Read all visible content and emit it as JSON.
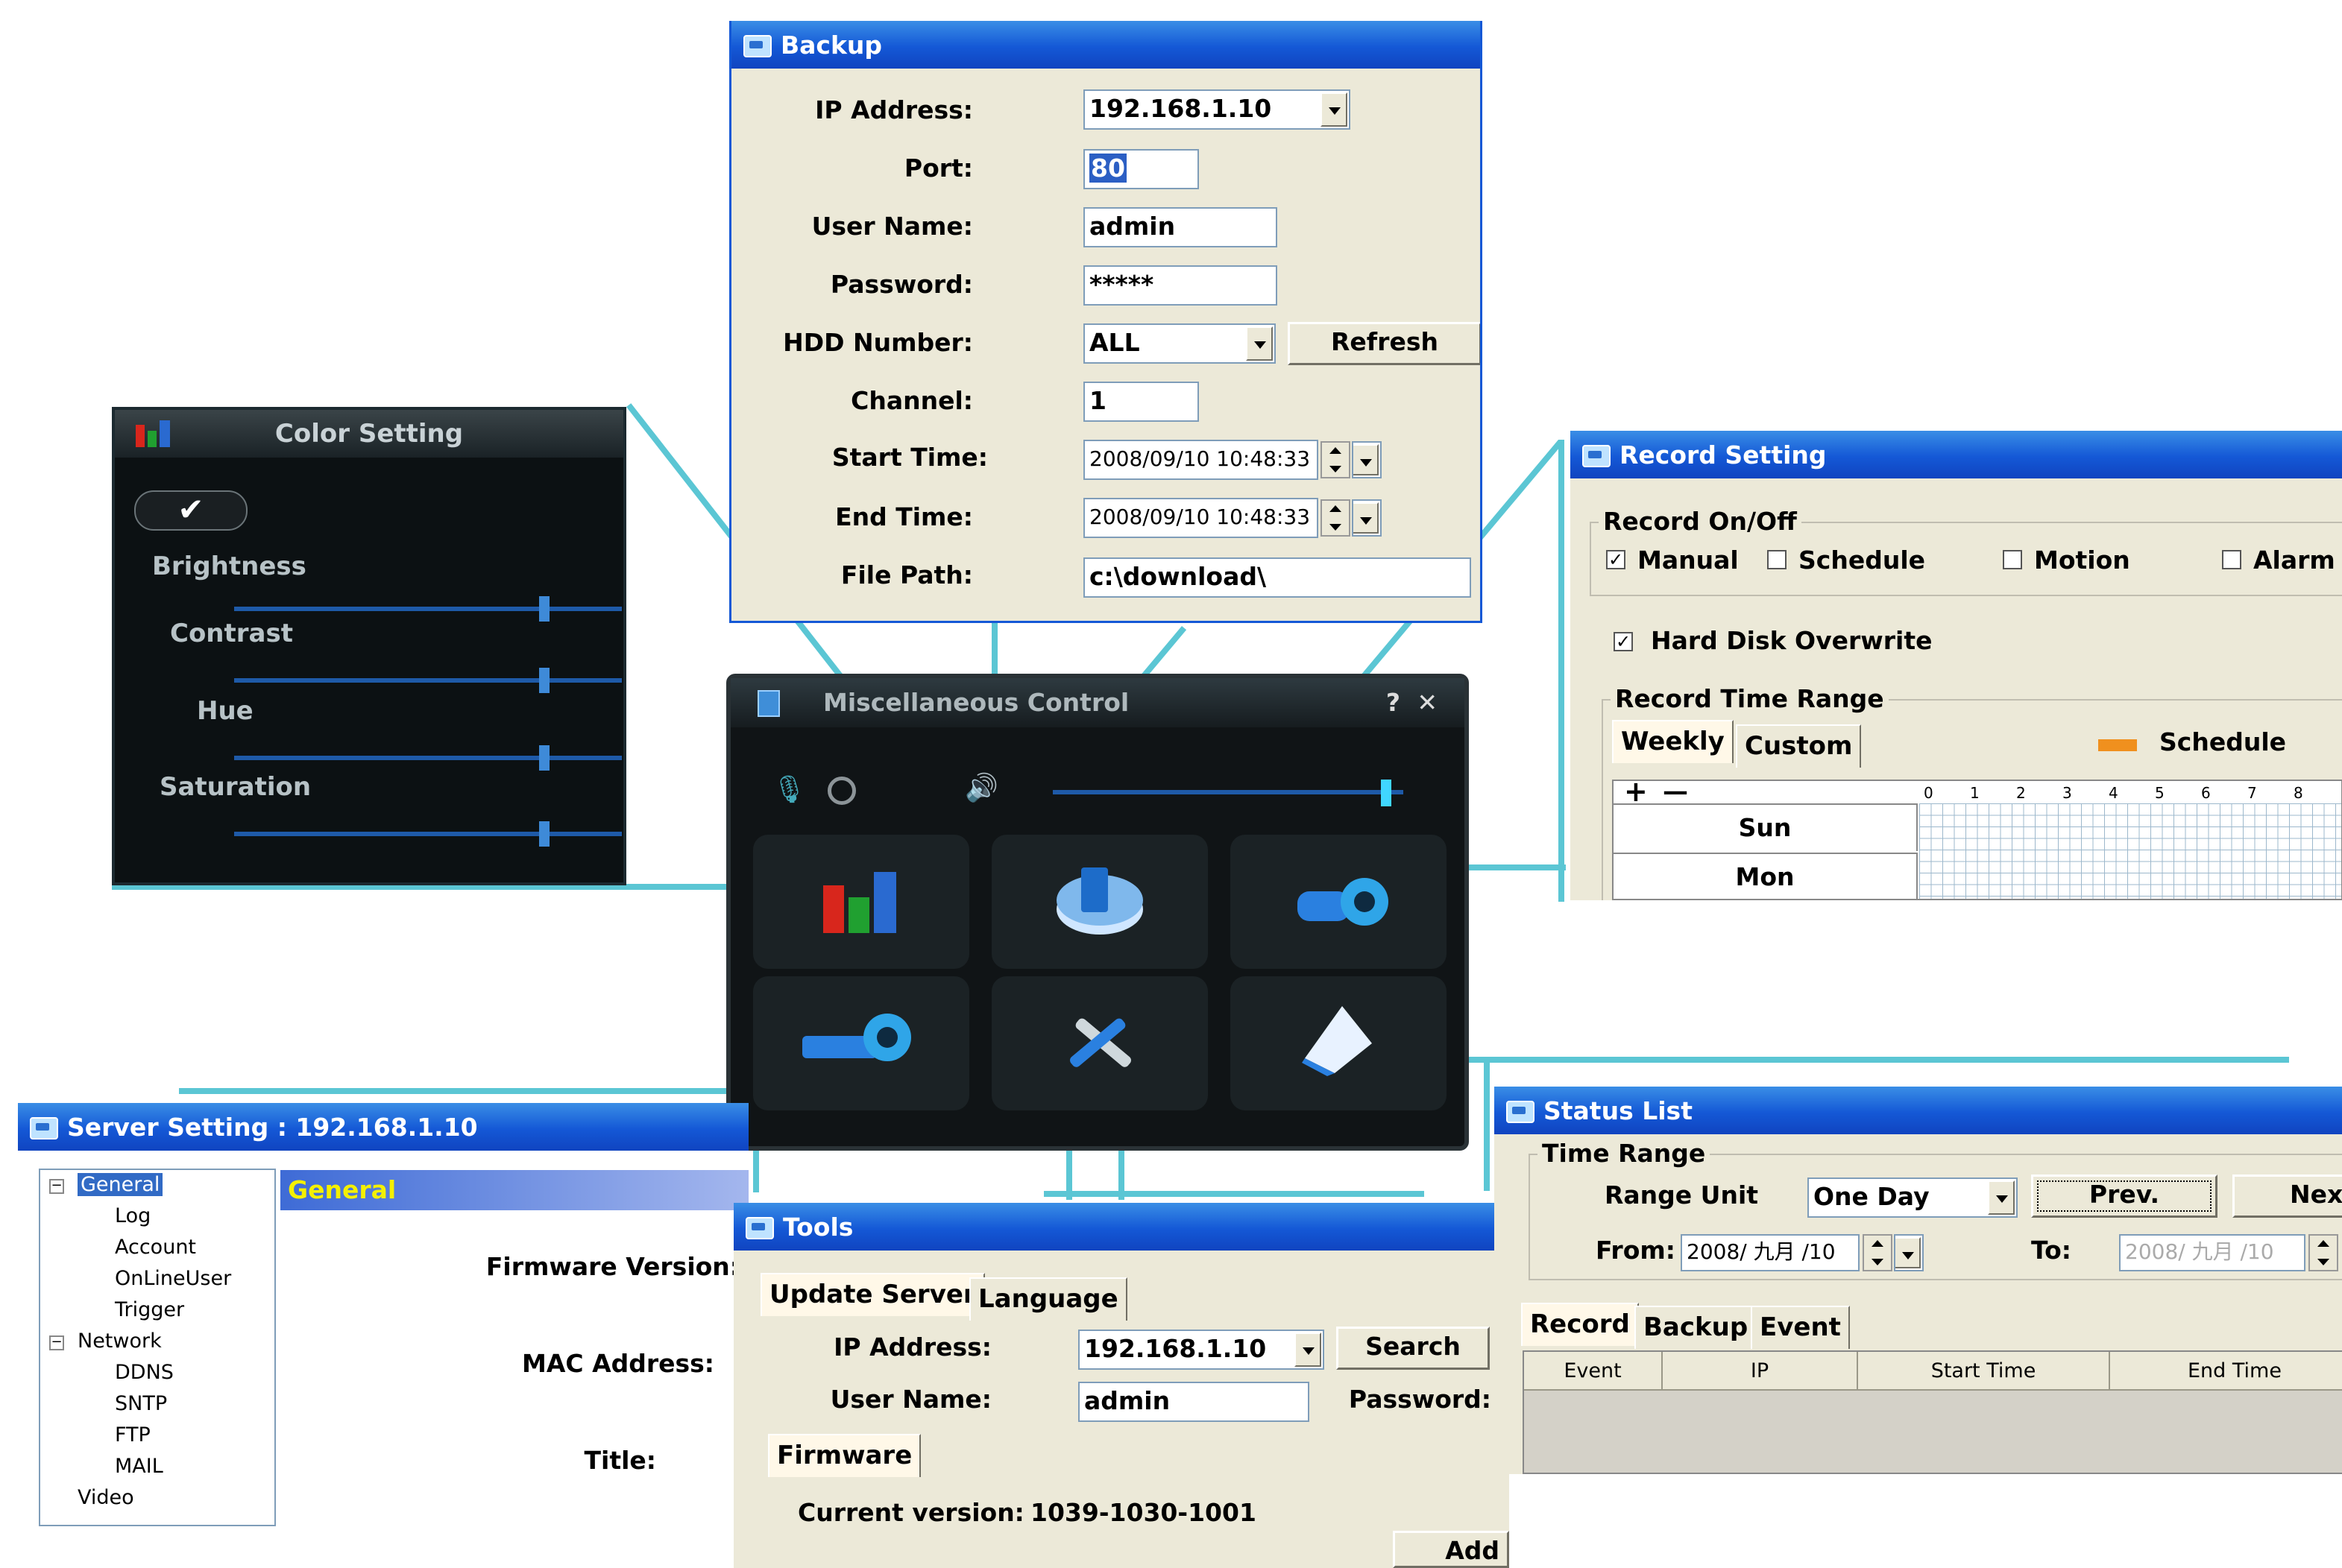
{
  "backup": {
    "title": "Backup",
    "labels": {
      "ip": "IP Address:",
      "port": "Port:",
      "user": "User Name:",
      "password": "Password:",
      "hdd": "HDD Number:",
      "channel": "Channel:",
      "start": "Start Time:",
      "end": "End Time:",
      "path": "File Path:"
    },
    "values": {
      "ip": "192.168.1.10",
      "port": "80",
      "user": "admin",
      "password": "*****",
      "hdd": "ALL",
      "channel": "1",
      "start": "2008/09/10 10:48:33",
      "end": "2008/09/10 10:48:33",
      "path": "c:\\download\\"
    },
    "refresh_label": "Refresh"
  },
  "color": {
    "title": "Color Setting",
    "items": [
      "Brightness",
      "Contrast",
      "Hue",
      "Saturation"
    ],
    "slider_levels": [
      0.8,
      0.8,
      0.8,
      0.8
    ]
  },
  "misc": {
    "title": "Miscellaneous Control",
    "help": "?",
    "close": "✕",
    "volume_level": 0.95
  },
  "record": {
    "title": "Record Setting",
    "group_onoff": "Record On/Off",
    "manual": "Manual",
    "schedule": "Schedule",
    "motion": "Motion",
    "alarm": "Alarm",
    "overwrite": "Hard Disk Overwrite",
    "group_range": "Record Time Range",
    "tab_weekly": "Weekly",
    "tab_custom": "Custom",
    "legend": "Schedule",
    "legend_color": "#f0901e",
    "plus": "+",
    "minus": "—",
    "hours": [
      "0",
      "1",
      "2",
      "3",
      "4",
      "5",
      "6",
      "7",
      "8"
    ],
    "days": [
      "Sun",
      "Mon"
    ]
  },
  "server": {
    "title": "Server Setting : 192.168.1.10",
    "tree": [
      "General",
      "Log",
      "Account",
      "OnLineUser",
      "Trigger",
      "Network",
      "DDNS",
      "SNTP",
      "FTP",
      "MAIL",
      "Video"
    ],
    "header": "General",
    "firmware": "Firmware Version:",
    "mac": "MAC Address:",
    "title_label": "Title:"
  },
  "tools": {
    "title": "Tools",
    "tab_update": "Update Server",
    "tab_language": "Language",
    "ip_label": "IP Address:",
    "ip_value": "192.168.1.10",
    "search": "Search",
    "user_label": "User Name:",
    "user_value": "admin",
    "password_label": "Password:",
    "firmware_tab": "Firmware",
    "current_label": "Current version:",
    "current_value": "1039-1030-1001",
    "add": "Add"
  },
  "status": {
    "title": "Status List",
    "group": "Time Range",
    "range_unit_label": "Range Unit",
    "range_unit_value": "One Day",
    "prev": "Prev.",
    "next": "Nex",
    "from_label": "From:",
    "from_value": "2008/ 九月 /10",
    "to_label": "To:",
    "to_value": "2008/ 九月 /10",
    "tabs": [
      "Record",
      "Backup",
      "Event"
    ],
    "columns": [
      "Event",
      "IP",
      "Start Time",
      "End Time"
    ]
  }
}
